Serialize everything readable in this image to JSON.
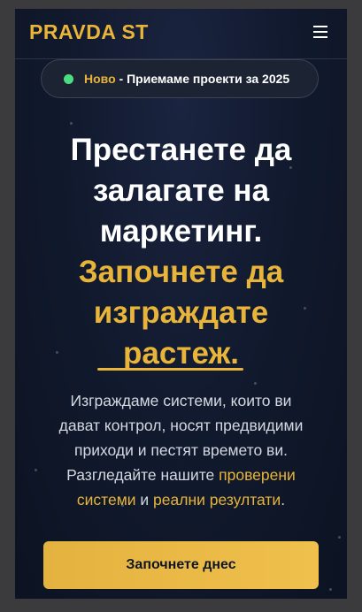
{
  "header": {
    "logo": "PRAVDA ST",
    "menu_icon": "hamburger-menu-icon"
  },
  "badge": {
    "status_color": "#4ade80",
    "new_label": "Ново",
    "separator": " - ",
    "text": "Приемаме проекти за 2025"
  },
  "hero": {
    "headline_lines": [
      "Престанете да",
      "залагате на",
      "маркетинг."
    ],
    "accent_lines": [
      "Започнете да",
      "изграждате",
      "растеж."
    ],
    "sub": {
      "line1": "Изграждаме системи, които ви",
      "line2": "дават контрол, носят предвидими",
      "line3": "приходи и пестят времето ви.",
      "line4_prefix": "Разгледайте нашите ",
      "link1": "проверени",
      "link1_cont": "системи",
      "conj": " и ",
      "link2": "реални резултати",
      "end": "."
    },
    "cta_label": "Започнете днес"
  },
  "colors": {
    "accent": "#e8b43a",
    "background": "#111a2e",
    "text": "#ffffff"
  }
}
